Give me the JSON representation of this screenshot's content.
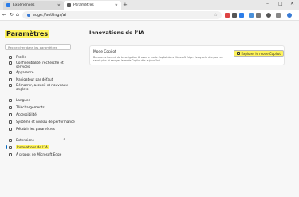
{
  "tabs": [
    {
      "label": "Expériences",
      "favicon_color": "#2b7de9",
      "active": false
    },
    {
      "label": "Paramètres",
      "favicon_color": "#5a5a5a",
      "active": true
    }
  ],
  "address_bar": {
    "url": "edge://settings/ai"
  },
  "sidebar": {
    "title": "Paramètres",
    "search_placeholder": "Rechercher dans les paramètres",
    "items": [
      {
        "label": "Profils",
        "icon": "person-icon"
      },
      {
        "label": "Confidentialité, recherche et services",
        "icon": "lock-icon"
      },
      {
        "label": "Apparence",
        "icon": "palette-icon"
      },
      {
        "label": "Navigateur par défaut",
        "icon": "browser-icon"
      },
      {
        "label": "Démarrer, accueil et nouveaux onglets",
        "icon": "home-icon"
      },
      {
        "label": "Langues",
        "icon": "language-icon"
      },
      {
        "label": "Téléchargements",
        "icon": "download-icon"
      },
      {
        "label": "Accessibilité",
        "icon": "accessibility-icon"
      },
      {
        "label": "Système et niveau de performance",
        "icon": "system-icon"
      },
      {
        "label": "Rétablir les paramètres",
        "icon": "reset-icon"
      },
      {
        "label": "Extensions",
        "icon": "puzzle-icon"
      },
      {
        "label": "Innovations de l’IA",
        "icon": "ai-icon"
      },
      {
        "label": "À propos de Microsoft Edge",
        "icon": "edge-icon"
      }
    ]
  },
  "main": {
    "title": "Innovations de l’IA",
    "card": {
      "title": "Mode Copilot",
      "description": "Découvrez l’avenir de la navigation IA avec le mode Copilot dans Microsoft Edge. Essayez-le dès pour en savoir plus et essayer le mode Copilot dès aujourd’hui.",
      "button_label": "Explorer le mode Copilot"
    }
  },
  "colors": {
    "highlight": "#fff45c",
    "accent": "#0067c0"
  }
}
